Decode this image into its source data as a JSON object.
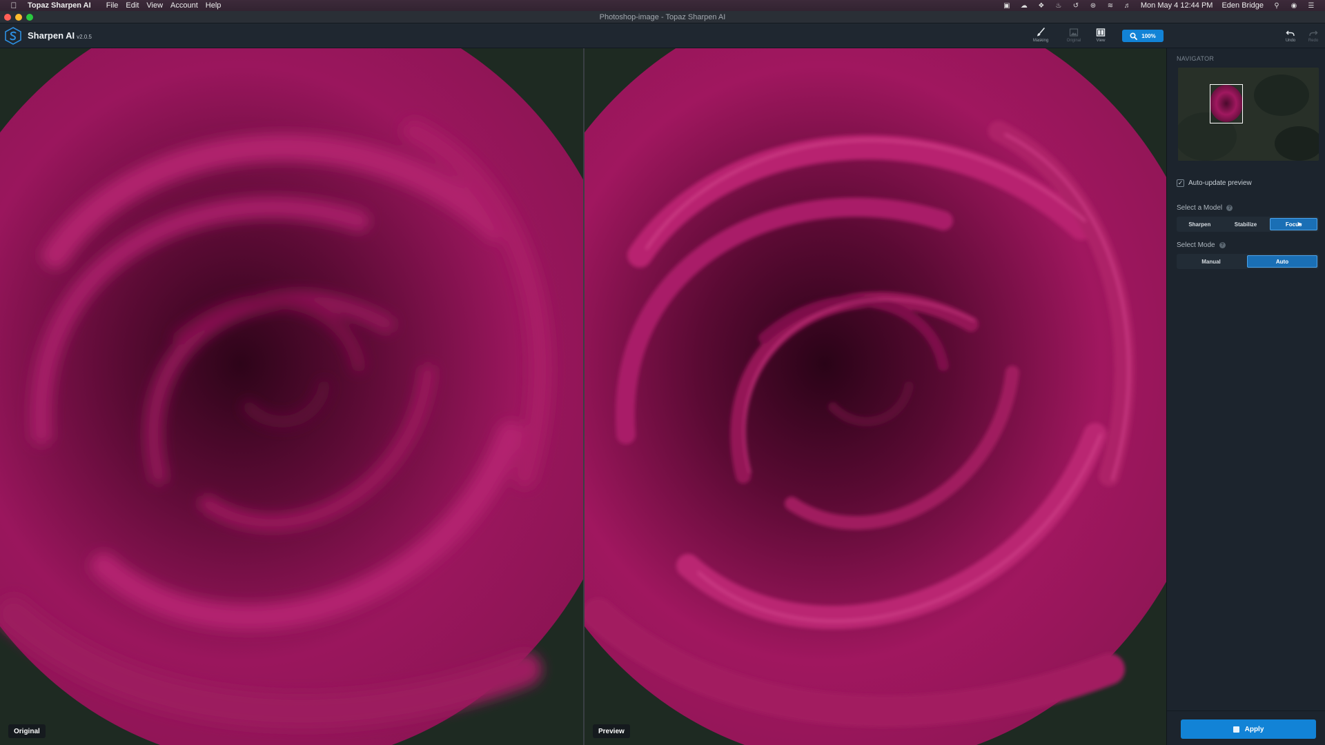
{
  "menubar": {
    "app_name": "Topaz Sharpen AI",
    "menus": [
      "File",
      "Edit",
      "View",
      "Account",
      "Help"
    ],
    "clock": "Mon May 4  12:44 PM",
    "user": "Eden Bridge"
  },
  "window": {
    "title": "Photoshop-image - Topaz Sharpen AI"
  },
  "toolbar": {
    "app_name": "Sharpen AI",
    "version": "v2.0.5",
    "masking_label": "Masking",
    "original_label": "Original",
    "view_label": "View",
    "zoom_label": "100%",
    "undo_label": "Undo",
    "redo_label": "Redo"
  },
  "viewports": {
    "original_label": "Original",
    "preview_label": "Preview"
  },
  "panel": {
    "navigator_title": "NAVIGATOR",
    "auto_update_label": "Auto-update preview",
    "auto_update_checked": true,
    "model_label": "Select a Model",
    "models": [
      "Sharpen",
      "Stabilize",
      "Focus"
    ],
    "selected_model": "Focus",
    "mode_label": "Select Mode",
    "modes": [
      "Manual",
      "Auto"
    ],
    "selected_mode": "Auto",
    "apply_label": "Apply"
  },
  "colors": {
    "accent": "#1283d6",
    "panel_bg": "#1c242d",
    "toolbar_bg": "#1f2730",
    "rose": "#a0165e"
  }
}
